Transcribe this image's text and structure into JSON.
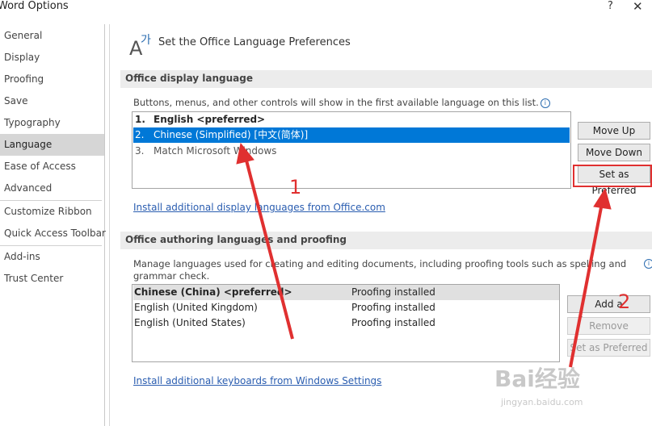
{
  "window": {
    "title": "Word Options",
    "help_label": "?",
    "close_label": "✕"
  },
  "sidebar": {
    "items": [
      {
        "label": "General"
      },
      {
        "label": "Display"
      },
      {
        "label": "Proofing"
      },
      {
        "label": "Save"
      },
      {
        "label": "Typography"
      },
      {
        "label": "Language"
      },
      {
        "label": "Ease of Access"
      },
      {
        "label": "Advanced"
      },
      {
        "label": "Customize Ribbon"
      },
      {
        "label": "Quick Access Toolbar"
      },
      {
        "label": "Add-ins"
      },
      {
        "label": "Trust Center"
      }
    ],
    "active": "Language"
  },
  "header": {
    "title": "Set the Office Language Preferences",
    "icon": "language-icon"
  },
  "display_section": {
    "title": "Office display language",
    "description": "Buttons, menus, and other controls will show in the first available language on this list.",
    "languages": [
      {
        "num": "1.",
        "label": "English <preferred>"
      },
      {
        "num": "2.",
        "label": "Chinese (Simplified) [中文(简体)]"
      },
      {
        "num": "3.",
        "label": "Match Microsoft Windows"
      }
    ],
    "buttons": {
      "move_up": "Move Up",
      "move_down": "Move Down",
      "set_preferred": "Set as Preferred"
    },
    "install_link": "Install additional display languages from Office.com"
  },
  "authoring_section": {
    "title": "Office authoring languages and proofing",
    "description": "Manage languages used for creating and editing documents, including proofing tools such as spelling and grammar check.",
    "rows": [
      {
        "language": "Chinese (China) <preferred>",
        "status": "Proofing installed"
      },
      {
        "language": "English (United Kingdom)",
        "status": "Proofing installed"
      },
      {
        "language": "English (United States)",
        "status": "Proofing installed"
      }
    ],
    "buttons": {
      "add": "Add a Language...",
      "remove": "Remove",
      "set_preferred": "Set as Preferred"
    },
    "install_link": "Install additional keyboards from Windows Settings"
  },
  "annotations": {
    "marker1": "1",
    "marker2": "2",
    "color": "#e03030"
  },
  "watermark": {
    "text": "Bai经验",
    "sub": "jingyan.baidu.com"
  }
}
